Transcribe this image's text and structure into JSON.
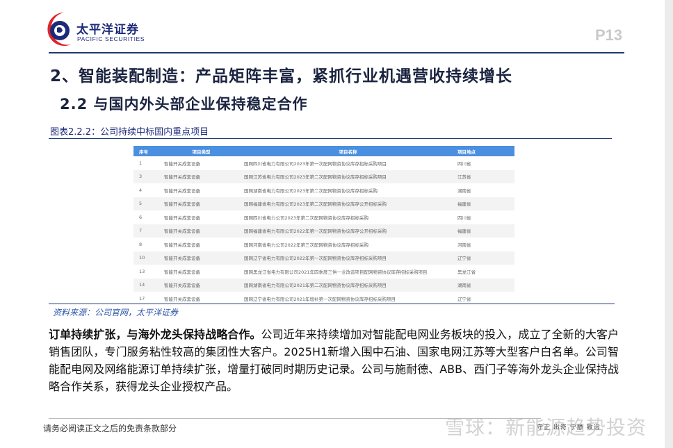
{
  "brand": {
    "cn": "太平洋证券",
    "en": "PACIFIC SECURITIES"
  },
  "page_number": "P13",
  "title": "2、智能装配制造：产品矩阵丰富，紧抓行业机遇营收持续增长",
  "subtitle": "2.2 与国内外头部企业保持稳定合作",
  "caption": "图表2.2.2：公司持续中标国内重点项目",
  "table": {
    "headers": [
      "序号",
      "项目类型",
      "项目名称",
      "项目地点"
    ],
    "rows": [
      [
        "1",
        "智能开关成套设备",
        "国网四川省电力有限公司2023年第一次配网物资协议库存招标采购项目",
        "四川省"
      ],
      [
        "3",
        "智能开关成套设备",
        "国网江苏省电力有限公司2023年第二次配网物资协议库存招标采购项目",
        "江苏省"
      ],
      [
        "4",
        "智能开关成套设备",
        "国网湖南省电力有限公司2023年第二次配网物资协议库存招标采购",
        "湖南省"
      ],
      [
        "5",
        "智能开关成套设备",
        "国网福建省电力有限公司2023年第二次配网物资协议库存公开招标采购",
        "福建省"
      ],
      [
        "6",
        "智能开关成套设备",
        "国网四川省电力公司2023年第二次配网物资协议库存招标采购",
        "四川省"
      ],
      [
        "7",
        "智能开关成套设备",
        "国网福建省电力有限公司2022年第一次配网物资协议库存公开招标采购",
        "福建省"
      ],
      [
        "8",
        "智能开关成套设备",
        "国网河南省电力公司2022年第三次配网物资协议库存招标采购",
        "河南省"
      ],
      [
        "10",
        "智能开关成套设备",
        "国网辽宁省电力有限公司2022年第一次配网物资协议库存招标采购项目",
        "辽宁省"
      ],
      [
        "13",
        "智能开关成套设备",
        "国网黑龙江省电力有限公司2021年四季度三供一业改造项目配网物资协议库存招标采购项目",
        "黑龙江省"
      ],
      [
        "14",
        "智能开关成套设备",
        "国网湖南省电力有限公司2021年第二次配网物资协议库存招标采购项目",
        "湖南省"
      ],
      [
        "17",
        "智能开关成套设备",
        "国网辽宁省电力有限公司2021年增补第一次配网物资协议库存招标采购项目",
        "辽宁省"
      ]
    ]
  },
  "source": "资料来源：公司官网，太平洋证券",
  "paragraph": {
    "lead": "订单持续扩张，与海外龙头保持战略合作。",
    "body": "公司近年来持续增加对智能配电网业务板块的投入，成立了全新的大客户销售团队，专门服务粘性较高的集团性大客户。2025H1新增入围中石油、国家电网江苏等大型客户白名单。公司智能配电网及网络能源订单持续扩张，增量打破同时期历史记录。公司与施耐德、ABB、西门子等海外龙头企业保持战略合作关系，获得龙头企业授权产品。"
  },
  "footer": {
    "disclaimer": "请务必阅读正文之后的免责条款部分",
    "slogan": "守正 出奇 宁静 致远"
  },
  "watermark": "雪球：新能源趋势投资"
}
